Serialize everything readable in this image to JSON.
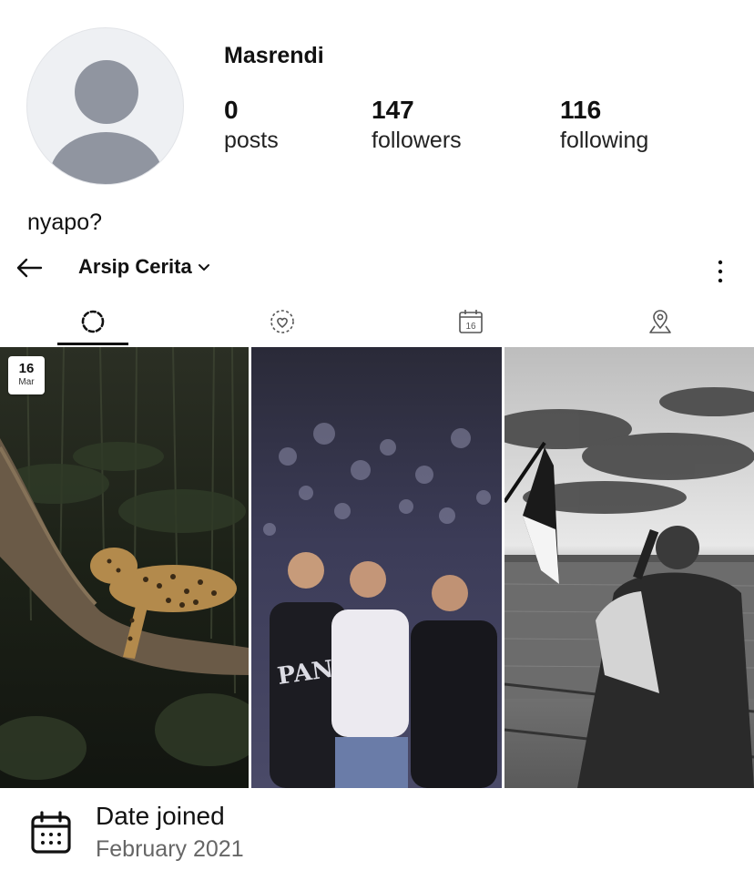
{
  "profile": {
    "username": "Masrendi",
    "stats": [
      {
        "value": "0",
        "label": "posts"
      },
      {
        "value": "147",
        "label": "followers"
      },
      {
        "value": "116",
        "label": "following"
      }
    ],
    "bio": "nyapo?"
  },
  "archive": {
    "title": "Arsip Cerita",
    "icons": {
      "back": "back-arrow-icon",
      "dropdown": "chevron-down-icon",
      "more": "more-vertical-icon"
    },
    "tabs": [
      {
        "name": "stories",
        "icon": "stories-ring-icon",
        "active": true
      },
      {
        "name": "highlights",
        "icon": "heart-ring-icon",
        "active": false
      },
      {
        "name": "calendar",
        "icon": "calendar-icon",
        "label": "16",
        "active": false
      },
      {
        "name": "map",
        "icon": "map-pin-icon",
        "active": false
      }
    ],
    "stories": [
      {
        "badge_day": "16",
        "badge_month": "Mar",
        "subject": "leopard resting on a tree branch"
      },
      {
        "subject": "four friends posing at night"
      },
      {
        "subject": "man drinking beside a flag on a boat, black and white"
      }
    ]
  },
  "joined": {
    "title": "Date joined",
    "value": "February 2021"
  }
}
